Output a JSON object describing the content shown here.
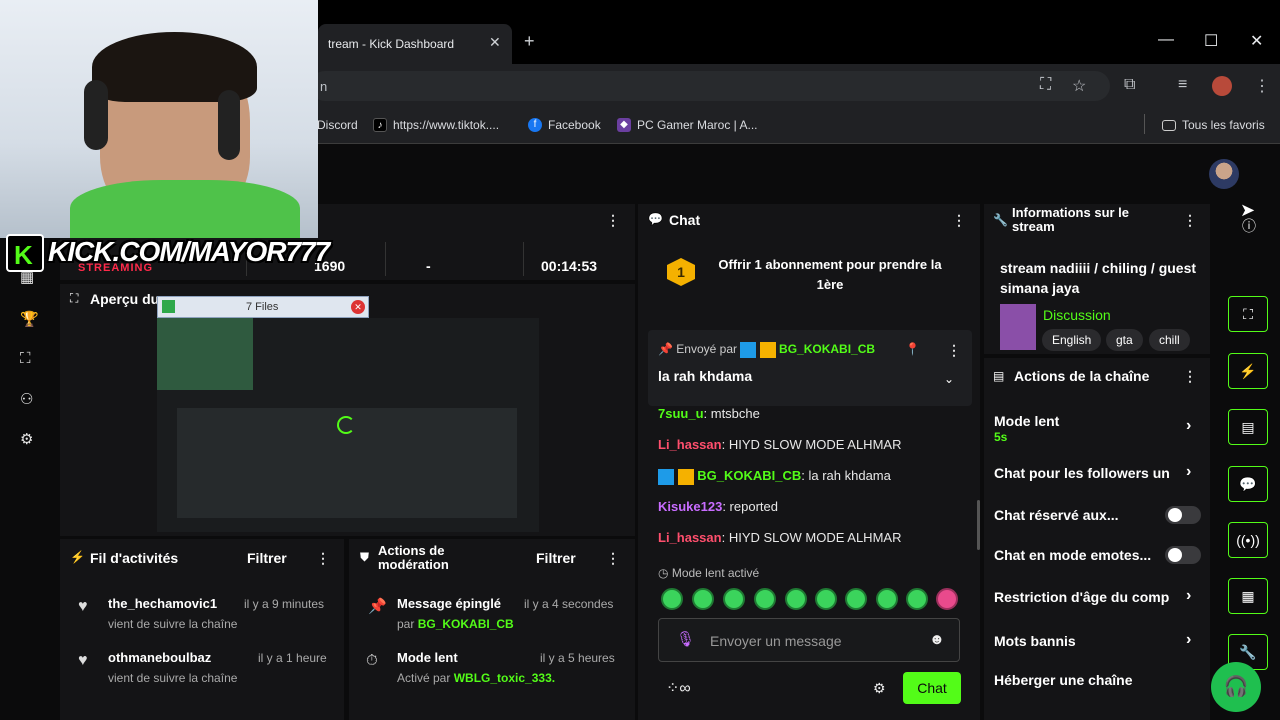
{
  "browser": {
    "tab_title": "tream - Kick Dashboard",
    "address": "n",
    "bookmarks": [
      "Discord",
      "https://www.tiktok....",
      "Facebook",
      "PC Gamer Maroc | A...",
      "Tous les favoris"
    ]
  },
  "overlay": {
    "stream_text": "STREAMING",
    "kick_url": "KICK.COM/MAYOR777",
    "kick_logo": "K"
  },
  "stats": {
    "viewers": "1690",
    "dash": "-",
    "duration": "00:14:53"
  },
  "preview": {
    "title": "Aperçu du",
    "popup_title": "7 Files"
  },
  "activity": {
    "title": "Fil d'activités",
    "filter": "Filtrer",
    "items": [
      {
        "name": "the_hechamovic1",
        "time": "il y a 9 minutes",
        "desc": "vient de suivre la chaîne"
      },
      {
        "name": "othmaneboulbaz",
        "time": "il y a 1 heure",
        "desc": "vient de suivre la chaîne"
      }
    ]
  },
  "moderation": {
    "title": "Actions de modération",
    "filter": "Filtrer",
    "items": [
      {
        "title": "Message épinglé",
        "time": "il y a 4 secondes",
        "by_label": "par",
        "by_user": "BG_KOKABI_CB"
      },
      {
        "title": "Mode lent",
        "time": "il y a 5 heures",
        "by_label": "Activé par",
        "by_user": "WBLG_toxic_333."
      }
    ]
  },
  "chat": {
    "title": "Chat",
    "gift_count": "1",
    "gift_text": "Offrir 1 abonnement pour prendre la 1ère",
    "pinned_label": "Envoyé par",
    "pinned_user": "BG_KOKABI_CB",
    "pinned_message": "la rah khdama",
    "messages": [
      {
        "user": "7suu_u",
        "text": ": mtsbche",
        "color": "#53fc18"
      },
      {
        "user": "Li_hassan",
        "text": ": HIYD SLOW MODE ALHMAR",
        "color": "#ff4f6d"
      },
      {
        "user": "BG_KOKABI_CB",
        "text": ": la rah khdama",
        "color": "#53fc18"
      },
      {
        "user": "Kisuke123",
        "text": ": reported",
        "color": "#c86cff"
      },
      {
        "user": "Li_hassan",
        "text": ": HIYD SLOW MODE ALHMAR",
        "color": "#ff4f6d"
      }
    ],
    "slow_mode_notice": "Mode lent activé",
    "input_placeholder": "Envoyer un message",
    "send_label": "Chat"
  },
  "stream_info": {
    "title": "Informations sur le stream",
    "stream_title": "stream nadiiii / chiling / guest simana jaya",
    "category": "Discussion",
    "tags": [
      "English",
      "gta",
      "chill"
    ]
  },
  "channel_actions": {
    "title": "Actions de la chaîne",
    "slow_mode": "Mode lent",
    "slow_mode_value": "5s",
    "followers_chat": "Chat pour les followers un",
    "reserved_chat": "Chat réservé aux...",
    "emote_chat": "Chat en mode emotes...",
    "age_restriction": "Restriction d'âge du comp",
    "banned_words": "Mots bannis",
    "host_channel": "Héberger une chaîne"
  },
  "colors": {
    "accent": "#53fc18",
    "panel": "#141416",
    "background": "#0b0b0c"
  }
}
